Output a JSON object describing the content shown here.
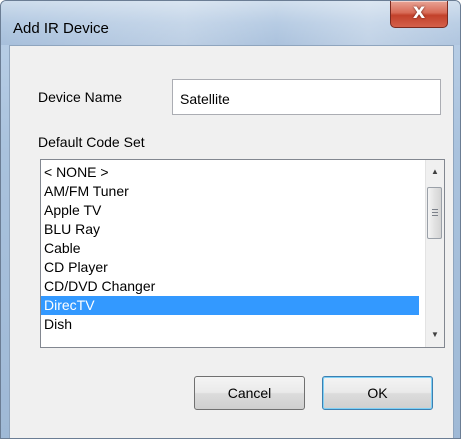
{
  "window": {
    "title": "Add IR Device",
    "close_glyph": "X"
  },
  "form": {
    "device_name_label": "Device Name",
    "device_name_value": "Satellite",
    "code_set_label": "Default Code Set"
  },
  "code_set_list": {
    "items": [
      {
        "label": "< NONE >",
        "selected": false
      },
      {
        "label": "AM/FM Tuner",
        "selected": false
      },
      {
        "label": "Apple TV",
        "selected": false
      },
      {
        "label": "BLU Ray",
        "selected": false
      },
      {
        "label": "Cable",
        "selected": false
      },
      {
        "label": "CD Player",
        "selected": false
      },
      {
        "label": "CD/DVD Changer",
        "selected": false
      },
      {
        "label": "DirecTV",
        "selected": true
      },
      {
        "label": "Dish",
        "selected": false
      }
    ],
    "scroll_up_icon": "triangle-up",
    "scroll_down_icon": "triangle-down"
  },
  "buttons": {
    "cancel_label": "Cancel",
    "ok_label": "OK"
  },
  "colors": {
    "selection": "#3399ff",
    "close_button": "#c2412b"
  }
}
